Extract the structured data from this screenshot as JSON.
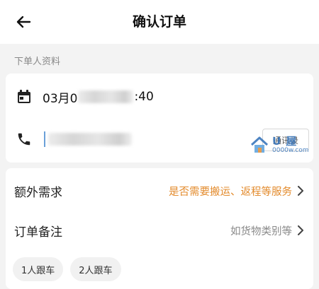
{
  "header": {
    "title": "确认订单",
    "back_icon": "arrow-left-icon"
  },
  "orderer_section": {
    "label": "下单人资料",
    "time_prefix": "03月0",
    "time_suffix": ":40",
    "calendar_icon": "calendar-icon",
    "phone_icon": "phone-icon",
    "contacts_button": "通讯录"
  },
  "watermark": {
    "main": "U 屋",
    "sub": "0000w.com"
  },
  "options": {
    "extra": {
      "title": "额外需求",
      "value": "是否需要搬运、返程等服务"
    },
    "remark": {
      "title": "订单备注",
      "value": "如货物类别等"
    }
  },
  "chips": [
    "1人跟车",
    "2人跟车"
  ],
  "colors": {
    "accent_orange": "#e38b2d",
    "muted": "#8a8a8a",
    "background": "#f3f3f3"
  }
}
